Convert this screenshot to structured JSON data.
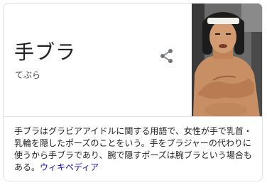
{
  "entity": {
    "title": "手ブラ",
    "reading": "てぶら"
  },
  "share": {
    "icon": "share-icon"
  },
  "image": {
    "icon": "person-photo"
  },
  "description": {
    "text": "手ブラはグラビアアイドルに関する用語で、女性が手で乳首・乳輪を隠したポーズのことをいう。手をブラジャーの代わりに使うから手ブラであり、腕で隠すポーズは腕ブラという場合もある。",
    "source_label": "ウィキペディア"
  },
  "colors": {
    "link": "#1a0dab",
    "border": "#dfe1e5",
    "icon": "#70757a"
  }
}
